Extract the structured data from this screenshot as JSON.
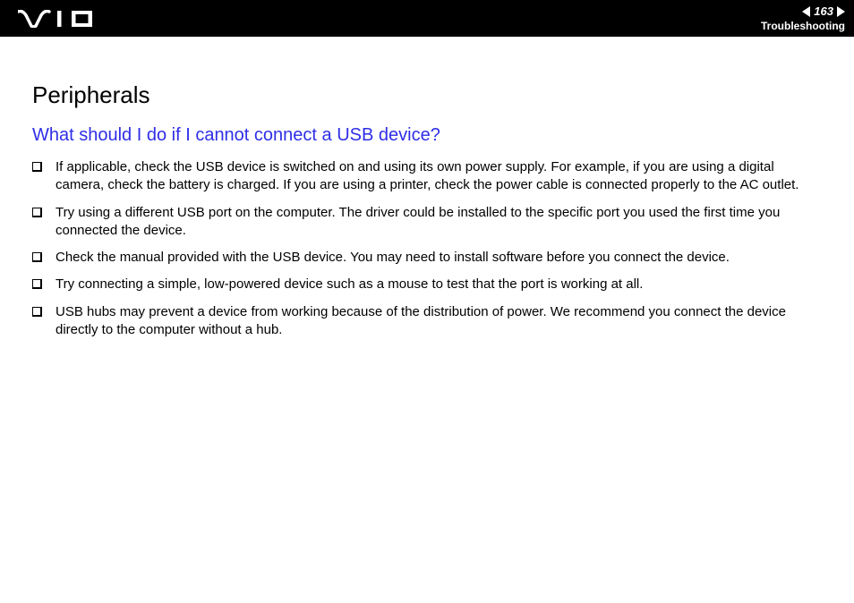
{
  "header": {
    "page_number": "163",
    "section": "Troubleshooting"
  },
  "content": {
    "title": "Peripherals",
    "subtitle": "What should I do if I cannot connect a USB device?",
    "bullets": [
      "If applicable, check the USB device is switched on and using its own power supply. For example, if you are using a digital camera, check the battery is charged. If you are using a printer, check the power cable is connected properly to the AC outlet.",
      "Try using a different USB port on the computer. The driver could be installed to the specific port you used the first time you connected the device.",
      "Check the manual provided with the USB device. You may need to install software before you connect the device.",
      "Try connecting a simple, low-powered device such as a mouse to test that the port is working at all.",
      "USB hubs may prevent a device from working because of the distribution of power. We recommend you connect the device directly to the computer without a hub."
    ]
  }
}
